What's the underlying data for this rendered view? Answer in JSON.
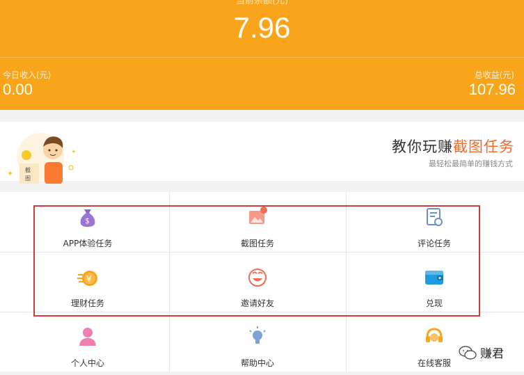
{
  "header": {
    "balance_label": "当前余额(元)",
    "balance_value": "7.96",
    "today_label": "今日收入(元)",
    "today_value": "0.00",
    "total_label": "总收益(元)",
    "total_value": "107.96"
  },
  "banner": {
    "title_prefix": "教你玩赚",
    "title_highlight": "截图任务",
    "subtitle": "最轻松最简单的赚钱方式",
    "sign_text_1": "截",
    "sign_text_2": "图"
  },
  "grid": {
    "items": [
      {
        "label": "APP体验任务",
        "icon": "money-bag-icon"
      },
      {
        "label": "截图任务",
        "icon": "image-icon"
      },
      {
        "label": "评论任务",
        "icon": "certificate-icon"
      },
      {
        "label": "理财任务",
        "icon": "coin-icon"
      },
      {
        "label": "邀请好友",
        "icon": "smiley-icon"
      },
      {
        "label": "兑现",
        "icon": "wallet-icon"
      },
      {
        "label": "个人中心",
        "icon": "person-icon"
      },
      {
        "label": "帮助中心",
        "icon": "lightbulb-icon"
      },
      {
        "label": "在线客服",
        "icon": "headset-icon"
      }
    ]
  },
  "watermark": {
    "text": "赚君"
  },
  "colors": {
    "accent": "#f8a51c",
    "highlight": "#f06a2c",
    "annotation": "#d23b3b"
  }
}
